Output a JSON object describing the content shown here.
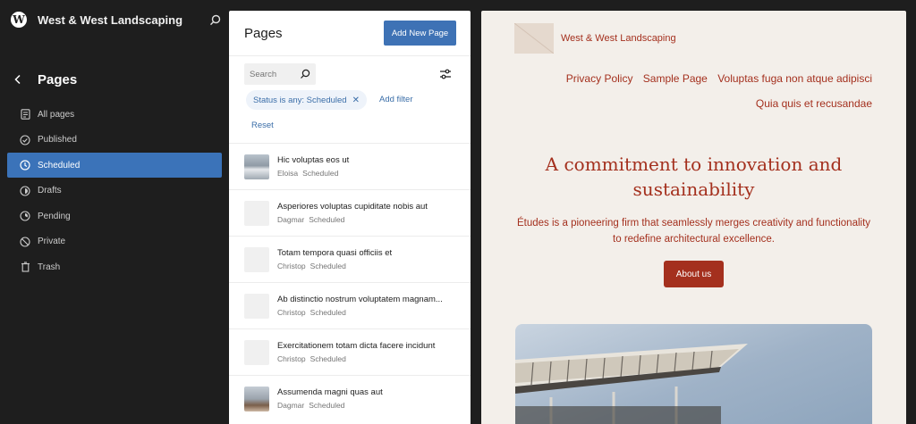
{
  "site": {
    "title": "West & West Landscaping"
  },
  "sidebar": {
    "section_title": "Pages",
    "items": [
      {
        "label": "All pages",
        "icon": "pages-icon",
        "active": false
      },
      {
        "label": "Published",
        "icon": "published-icon",
        "active": false
      },
      {
        "label": "Scheduled",
        "icon": "scheduled-icon",
        "active": true
      },
      {
        "label": "Drafts",
        "icon": "drafts-icon",
        "active": false
      },
      {
        "label": "Pending",
        "icon": "pending-icon",
        "active": false
      },
      {
        "label": "Private",
        "icon": "private-icon",
        "active": false
      },
      {
        "label": "Trash",
        "icon": "trash-icon",
        "active": false
      }
    ]
  },
  "pages_panel": {
    "title": "Pages",
    "add_button": "Add New Page",
    "search_placeholder": "Search",
    "filter_chip": "Status is any: Scheduled",
    "add_filter": "Add filter",
    "reset": "Reset",
    "rows": [
      {
        "title": "Hic voluptas eos ut",
        "author": "Eloisa",
        "status": "Scheduled",
        "thumb": "photo1"
      },
      {
        "title": "Asperiores voluptas cupiditate nobis aut",
        "author": "Dagmar",
        "status": "Scheduled",
        "thumb": "blank"
      },
      {
        "title": "Totam tempora quasi officiis et",
        "author": "Christop",
        "status": "Scheduled",
        "thumb": "blank"
      },
      {
        "title": "Ab distinctio nostrum voluptatem magnam...",
        "author": "Christop",
        "status": "Scheduled",
        "thumb": "blank"
      },
      {
        "title": "Exercitationem totam dicta facere incidunt",
        "author": "Christop",
        "status": "Scheduled",
        "thumb": "blank"
      },
      {
        "title": "Assumenda magni quas aut",
        "author": "Dagmar",
        "status": "Scheduled",
        "thumb": "photo2"
      }
    ]
  },
  "preview": {
    "brand": "West & West Landscaping",
    "nav": [
      "Privacy Policy",
      "Sample Page",
      "Voluptas fuga non atque adipisci",
      "Quia quis et recusandae"
    ],
    "hero_title": "A commitment to innovation and sustainability",
    "hero_desc": "Études is a pioneering firm that seamlessly merges creativity and functionality to redefine architectural excellence.",
    "cta": "About us"
  },
  "colors": {
    "accent": "#3b73b9",
    "preview_text": "#a4301e",
    "preview_bg": "#f3efea"
  }
}
